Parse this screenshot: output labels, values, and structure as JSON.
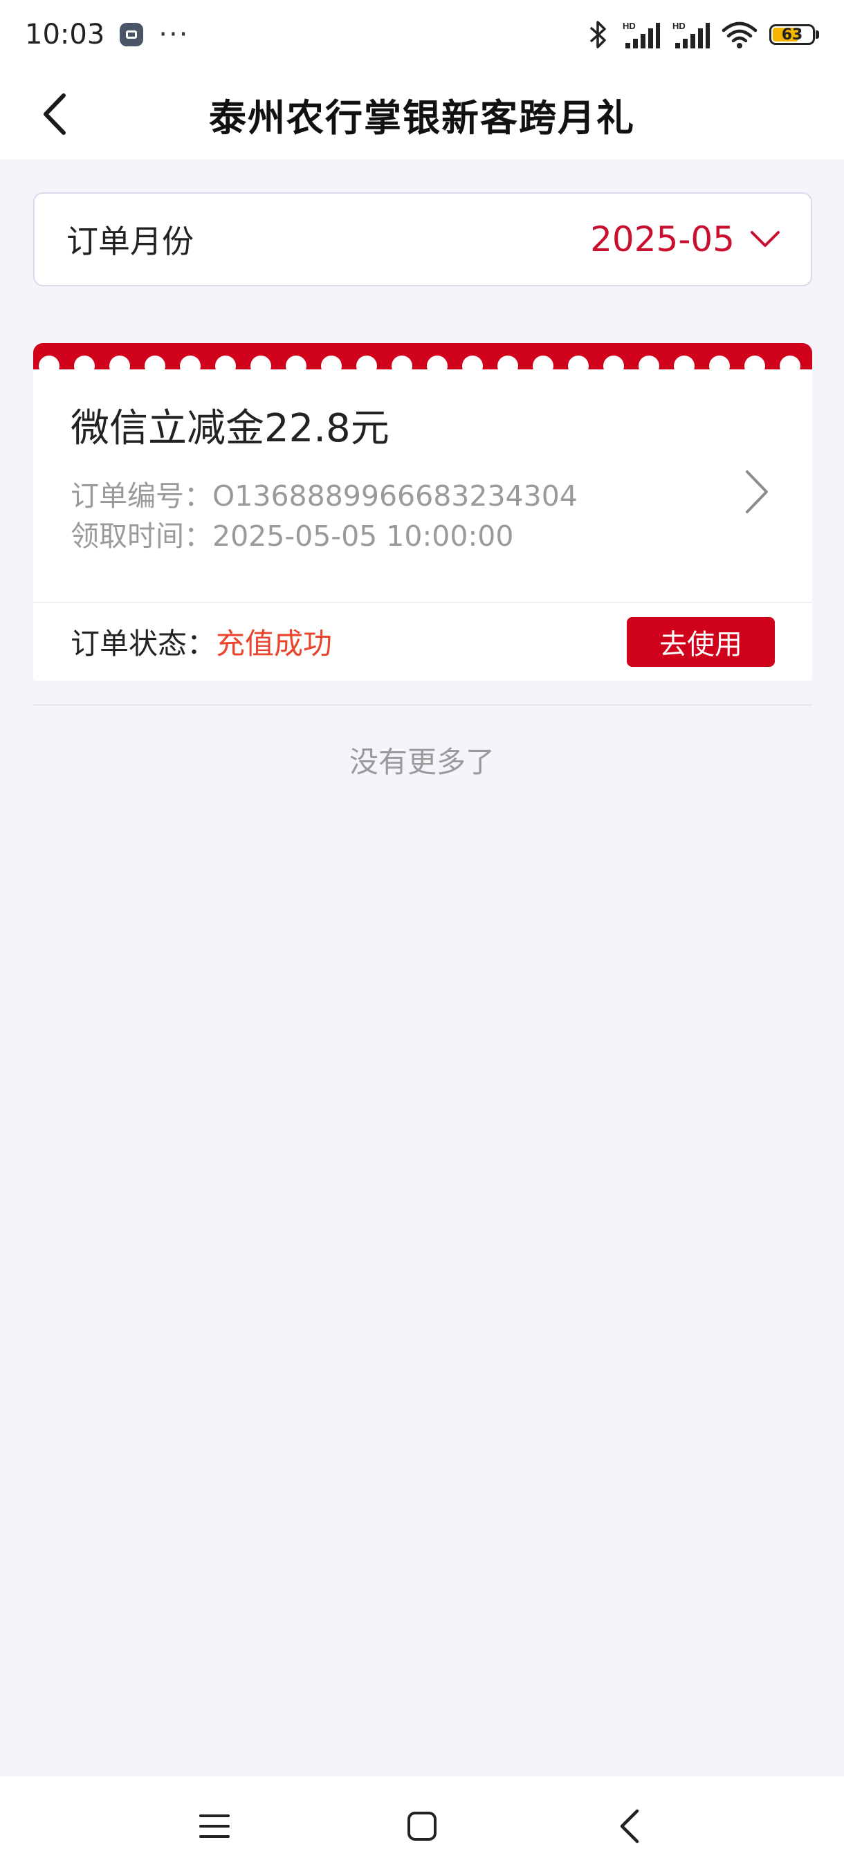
{
  "status_bar": {
    "time": "10:03",
    "more": "···",
    "icons": [
      "app-icon",
      "bluetooth-icon",
      "signal-hd-icon",
      "signal-hd-icon",
      "wifi-icon",
      "battery-icon"
    ],
    "signal_label": "HD",
    "battery_level": "63"
  },
  "header": {
    "title": "泰州农行掌银新客跨月礼",
    "back_icon": "chevron-left-icon"
  },
  "month_selector": {
    "label": "订单月份",
    "value": "2025-05",
    "icon": "chevron-down-icon"
  },
  "orders": [
    {
      "title": "微信立减金22.8元",
      "order_no_label": "订单编号：",
      "order_no": "O1368889966683234304",
      "claim_time_label": "领取时间：",
      "claim_time": "2025-05-05 10:00:00",
      "status_label": "订单状态：",
      "status": "充值成功",
      "action_label": "去使用"
    }
  ],
  "list_footer": "没有更多了",
  "nav_bar": {
    "icons": [
      "menu-icon",
      "home-icon",
      "back-icon"
    ]
  },
  "colors": {
    "accent": "#d0021b",
    "month_text": "#c8102e",
    "status_success": "#e8452c",
    "background": "#f4f4fa"
  }
}
